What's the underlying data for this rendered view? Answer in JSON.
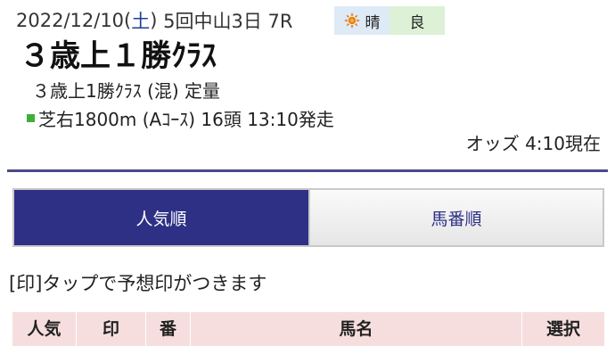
{
  "race": {
    "date": "2022/12/10",
    "day_open": "(",
    "day_of_week": "土",
    "day_close": ")",
    "meeting": "5回中山3日 7R",
    "weather": "晴",
    "track_condition": "良",
    "title": "３歳上１勝ｸﾗｽ",
    "conditions": "３歳上1勝ｸﾗｽ (混) 定量",
    "course": "芝右1800m (Aｺｰｽ) 16頭 13:10発走",
    "odds_time": "オッズ 4:10現在"
  },
  "colors": {
    "accent": "#2e3085",
    "divider": "#4a4a8a",
    "weather_bg": "#dfeaf7",
    "track_bg": "#dcf1d6",
    "turf_marker": "#3fae3a",
    "header_bg": "#f7dede"
  },
  "icons": {
    "weather": "sun-icon",
    "course": "turf-square-icon"
  },
  "tabs": {
    "popularity": "人気順",
    "horse_number": "馬番順",
    "selected": "人気順"
  },
  "hint": "[印]タップで予想印がつきます",
  "table": {
    "headers": [
      "人気",
      "印",
      "番",
      "馬名",
      "選択"
    ]
  }
}
